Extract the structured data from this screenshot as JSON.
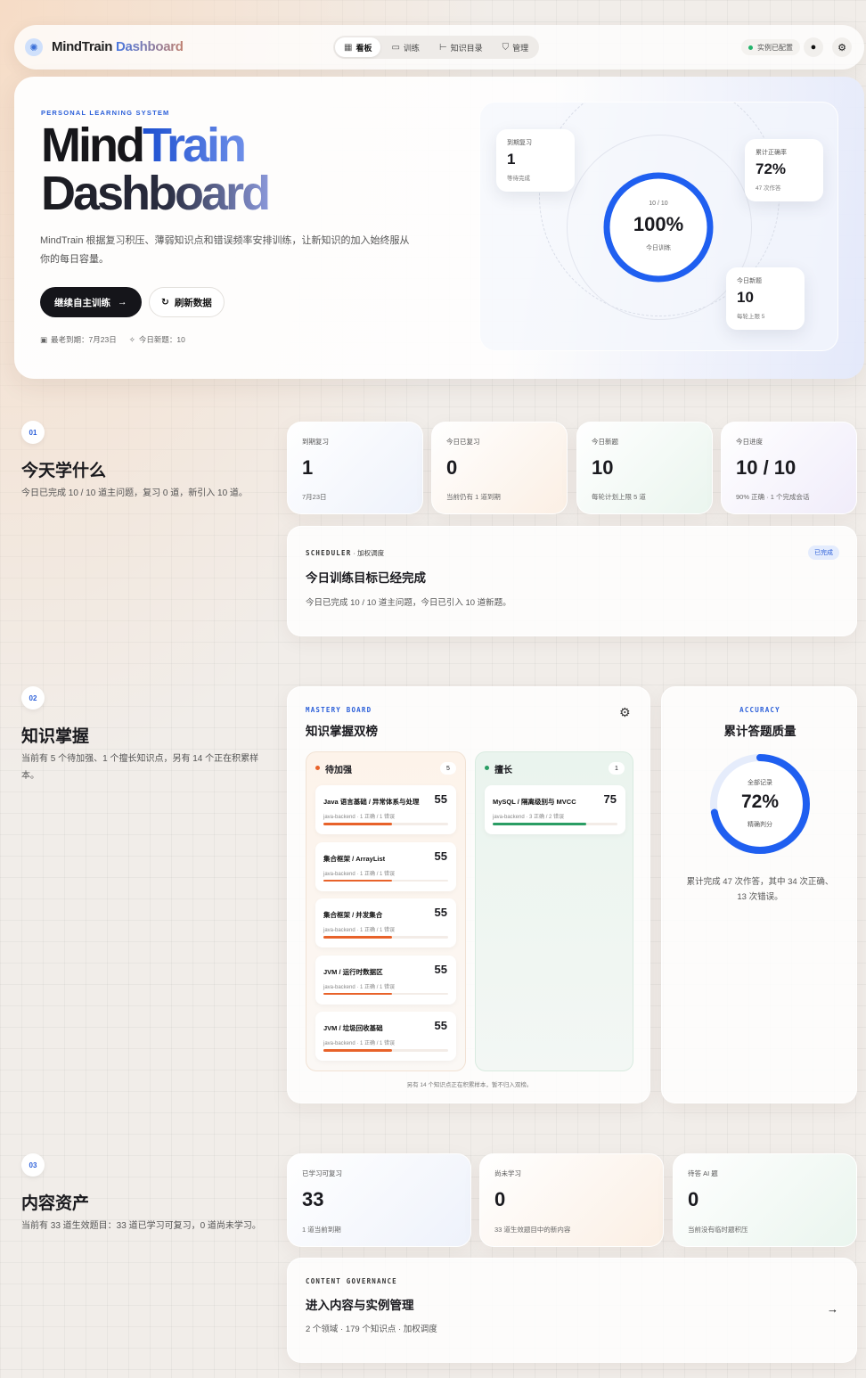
{
  "nav": {
    "brand_a": "MindTrain",
    "brand_b": "Dashboard",
    "tabs": [
      {
        "label": "看板",
        "icon": "grid-icon"
      },
      {
        "label": "训练",
        "icon": "book-icon"
      },
      {
        "label": "知识目录",
        "icon": "tree-icon"
      },
      {
        "label": "管理",
        "icon": "shield-icon"
      }
    ],
    "status": "实例已配置"
  },
  "hero": {
    "eyebrow": "PERSONAL LEARNING SYSTEM",
    "title_line1_a": "Mind",
    "title_line1_b": "Train",
    "title_line2": "Dashboard",
    "desc": "MindTrain 根据复习积压、薄弱知识点和错误频率安排训练，让新知识的加入始终服从你的每日容量。",
    "primary_btn": "继续自主训练",
    "secondary_btn": "刷新数据",
    "meta_due": "最老到期：7月23日",
    "meta_new": "今日新题：10",
    "orbit": {
      "center_top": "10 / 10",
      "center_big": "100%",
      "center_sub": "今日训练",
      "progress": 1.0,
      "card_due": {
        "label": "到期复习",
        "value": "1",
        "sub": "等待完成"
      },
      "card_acc": {
        "label": "累计正确率",
        "value": "72%",
        "sub": "47 次作答"
      },
      "card_new": {
        "label": "今日新题",
        "value": "10",
        "sub": "每轮上限 5"
      }
    }
  },
  "sec1": {
    "num": "01",
    "title": "今天学什么",
    "desc": "今日已完成 10 / 10 道主问题，复习 0 道，新引入 10 道。",
    "stats": [
      {
        "label": "到期复习",
        "value": "1",
        "sub": "7月23日"
      },
      {
        "label": "今日已复习",
        "value": "0",
        "sub": "当前仍有 1 道到期"
      },
      {
        "label": "今日新题",
        "value": "10",
        "sub": "每轮计划上限 5 道"
      },
      {
        "label": "今日进度",
        "value": "10 / 10",
        "sub": "90% 正确 · 1 个完成会话"
      }
    ],
    "scheduler": {
      "cap": "SCHEDULER",
      "cap_suffix": " · 加权调度",
      "badge": "已完成",
      "title": "今日训练目标已经完成",
      "desc": "今日已完成 10 / 10 道主问题，今日已引入 10 道新题。"
    }
  },
  "sec2": {
    "num": "02",
    "title": "知识掌握",
    "desc": "当前有 5 个待加强、1 个擅长知识点，另有 14 个正在积累样本。",
    "board": {
      "cap": "MASTERY BOARD",
      "title": "知识掌握双榜",
      "weak": {
        "title": "待加强",
        "count": "5",
        "items": [
          {
            "name": "Java 语言基础 / 异常体系与处理",
            "score": "55",
            "meta": "java-backend · 1 正确 / 1 错误",
            "ratio": 0.55
          },
          {
            "name": "集合框架 / ArrayList",
            "score": "55",
            "meta": "java-backend · 1 正确 / 1 错误",
            "ratio": 0.55
          },
          {
            "name": "集合框架 / 并发集合",
            "score": "55",
            "meta": "java-backend · 1 正确 / 1 错误",
            "ratio": 0.55
          },
          {
            "name": "JVM / 运行时数据区",
            "score": "55",
            "meta": "java-backend · 1 正确 / 1 错误",
            "ratio": 0.55
          },
          {
            "name": "JVM / 垃圾回收基础",
            "score": "55",
            "meta": "java-backend · 1 正确 / 1 错误",
            "ratio": 0.55
          }
        ]
      },
      "strong": {
        "title": "擅长",
        "count": "1",
        "items": [
          {
            "name": "MySQL / 隔离级别与 MVCC",
            "score": "75",
            "meta": "java-backend · 3 正确 / 2 错误",
            "ratio": 0.75
          }
        ]
      },
      "footer": "另有 14 个知识点正在积累样本，暂不归入双榜。"
    },
    "accuracy": {
      "cap": "ACCURACY",
      "title": "累计答题质量",
      "ring_top": "全部记录",
      "ring_big": "72%",
      "ring_sub": "精确判分",
      "ratio": 0.72,
      "desc": "累计完成 47 次作答，其中 34 次正确、13 次错误。"
    }
  },
  "sec3": {
    "num": "03",
    "title": "内容资产",
    "desc": "当前有 33 道生效题目：33 道已学习可复习，0 道尚未学习。",
    "stats": [
      {
        "label": "已学习可复习",
        "value": "33",
        "sub": "1 道当前到期"
      },
      {
        "label": "尚未学习",
        "value": "0",
        "sub": "33 道生效题目中的新内容"
      },
      {
        "label": "待答 AI 题",
        "value": "0",
        "sub": "当前没有临时题积压"
      }
    ],
    "governance": {
      "cap": "CONTENT GOVERNANCE",
      "title": "进入内容与实例管理",
      "desc": "2 个领域 · 179 个知识点 · 加权调度"
    }
  },
  "colors": {
    "accent": "#1f5ff0",
    "weak": "#e8622a",
    "strong": "#2a9d64",
    "dark": "#15151a"
  }
}
